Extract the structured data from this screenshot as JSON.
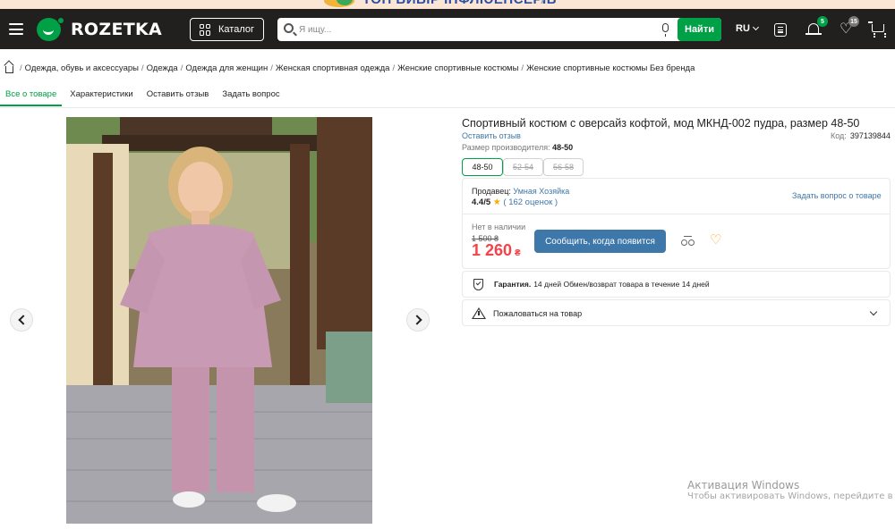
{
  "promo": {
    "text": "ТОП ВИБІР ІНФЛЮЕНСЕРІВ"
  },
  "header": {
    "logo": "ROZETKA",
    "catalog_label": "Каталог",
    "search_placeholder": "Я ищу...",
    "search_button": "Найти",
    "language": "RU",
    "notifications_count": "5",
    "wishlist_count": "15"
  },
  "breadcrumbs": [
    "Одежда, обувь и аксессуары",
    "Одежда",
    "Одежда для женщин",
    "Женская спортивная одежда",
    "Женские спортивные костюмы",
    "Женские спортивные костюмы Без бренда"
  ],
  "tabs": [
    "Все о товаре",
    "Характеристики",
    "Оставить отзыв",
    "Задать вопрос"
  ],
  "product": {
    "title": "Спортивный костюм с оверсайз кофтой, мод МКНД-002 пудра, размер 48-50",
    "review_link": "Оставить отзыв",
    "code_label": "Код:",
    "code": "397139844",
    "mfr_size_label": "Размер производителя:",
    "mfr_size": "48-50",
    "sizes": [
      "48-50",
      "52-54",
      "56-58"
    ]
  },
  "seller": {
    "label": "Продавец:",
    "name": "Умная Хозяйка",
    "rating": "4.4/5",
    "reviews": "( 162 оценок )",
    "ask_link": "Задать вопрос о товаре"
  },
  "offer": {
    "stock": "Нет в наличии",
    "old_price": "1 500 ₴",
    "price": "1 260",
    "currency": "₴",
    "notify_button": "Сообщить, когда появится"
  },
  "warranty": {
    "label": "Гарантия.",
    "text": "14 дней Обмен/возврат товара в течение 14 дней"
  },
  "complain": {
    "label": "Пожаловаться на товар"
  },
  "watermark": {
    "title": "Активация Windows",
    "subtitle": "Чтобы активировать Windows, перейдите в раздел"
  },
  "colors": {
    "brand_green": "#00a046",
    "link_blue": "#3e77aa",
    "price_red": "#f84147",
    "header_dark": "#221f1f"
  }
}
